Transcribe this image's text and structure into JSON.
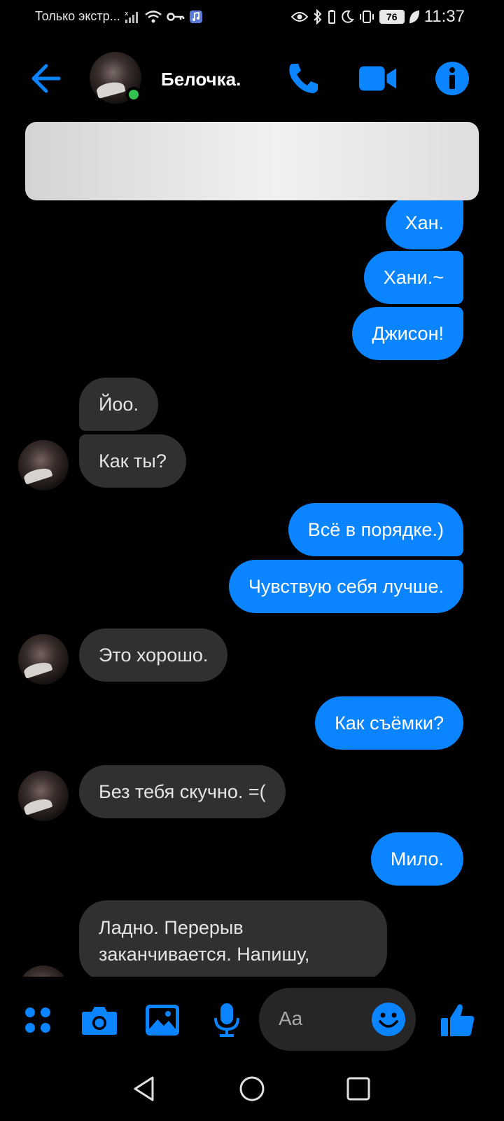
{
  "status_bar": {
    "carrier_text": "Только экстр...",
    "battery": "76",
    "time": "11:37",
    "icons": [
      "signal-off-icon",
      "wifi-icon",
      "key-icon",
      "music-app-icon",
      "eye-icon",
      "bluetooth-icon",
      "moon-icon",
      "vibrate-icon",
      "battery-icon",
      "leaf-icon"
    ]
  },
  "header": {
    "contact_name": "Белочка.",
    "online": true,
    "icons": [
      "back-arrow-icon",
      "phone-icon",
      "video-camera-icon",
      "info-icon"
    ]
  },
  "messages": [
    {
      "side": "out",
      "text": "Хан."
    },
    {
      "side": "out",
      "text": "Хани.~"
    },
    {
      "side": "out",
      "text": "Джисон!"
    },
    {
      "side": "in",
      "text": "Йоо."
    },
    {
      "side": "in",
      "text": "Как ты?"
    },
    {
      "side": "out",
      "text": "Всё в порядке.)"
    },
    {
      "side": "out",
      "text": "Чувствую себя лучше."
    },
    {
      "side": "in",
      "text": "Это хорошо."
    },
    {
      "side": "out",
      "text": "Как съёмки?"
    },
    {
      "side": "in",
      "text": "Без тебя скучно. =("
    },
    {
      "side": "out",
      "text": "Мило."
    },
    {
      "side": "in",
      "text": "Ладно. Перерыв заканчивается. Напишу,"
    }
  ],
  "composer": {
    "placeholder": "Aa",
    "icons": [
      "apps-grid-icon",
      "camera-icon",
      "gallery-icon",
      "microphone-icon",
      "emoji-icon",
      "thumbs-up-icon"
    ]
  },
  "nav_bar": {
    "icons": [
      "back-triangle-icon",
      "home-circle-icon",
      "recents-square-icon"
    ]
  },
  "colors": {
    "accent": "#0a84ff",
    "incoming_bubble": "#303030",
    "background": "#000000",
    "online": "#31c24d"
  }
}
